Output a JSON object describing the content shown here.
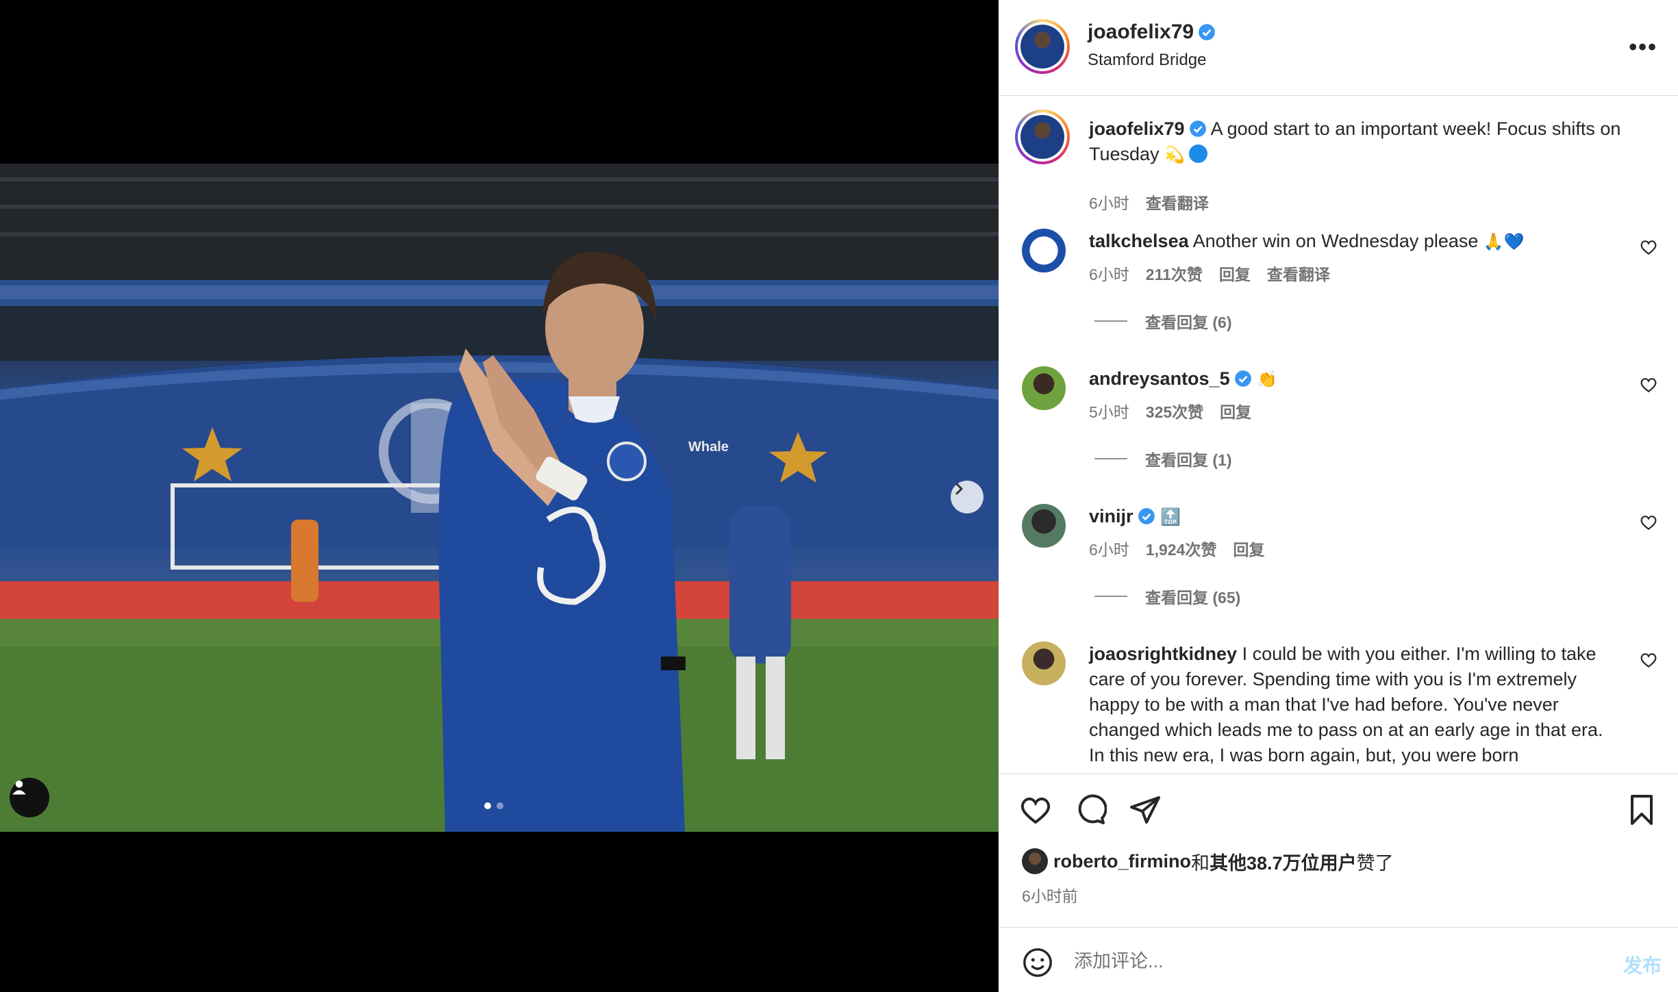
{
  "post": {
    "username": "joaofelix79",
    "location": "Stamford Bridge",
    "caption": "A good start to an important week! Focus shifts on Tuesday",
    "caption_emoji": "💫",
    "caption_time": "6小时",
    "translate_label": "查看翻译",
    "carousel": {
      "slides": 2,
      "current": 1
    }
  },
  "comments": [
    {
      "username": "talkchelsea",
      "text": "Another win on Wednesday please",
      "emoji": "🙏💙",
      "time": "6小时",
      "likes": "211次赞",
      "reply_label": "回复",
      "translate_label": "查看翻译",
      "view_replies": "查看回复 (6)"
    },
    {
      "username": "andreysantos_5",
      "text": "",
      "emoji": "👏",
      "time": "5小时",
      "likes": "325次赞",
      "reply_label": "回复",
      "view_replies": "查看回复 (1)"
    },
    {
      "username": "vinijr",
      "text": "",
      "emoji": "🔝",
      "time": "6小时",
      "likes": "1,924次赞",
      "reply_label": "回复",
      "view_replies": "查看回复 (65)"
    },
    {
      "username": "joaosrightkidney",
      "text": "I could be with you either. I'm willing to take care of you forever. Spending time with you is I'm extremely happy to be with a man that I've had before. You've never changed which leads me to pass on at an early age in that era. In this new era, I was born again, but, you were born"
    }
  ],
  "likes_summary": {
    "user": "roberto_firmino",
    "rest": "和其他38.7万位用户赞了",
    "others": "其他38.7万位用户",
    "joiner": "和",
    "tail": "赞了"
  },
  "post_time": "6小时前",
  "composer": {
    "placeholder": "添加评论...",
    "post_label": "发布"
  },
  "colors": {
    "verified": "#3897f0",
    "link_blue": "#b2dffc",
    "text": "#262626",
    "muted": "#737373"
  }
}
